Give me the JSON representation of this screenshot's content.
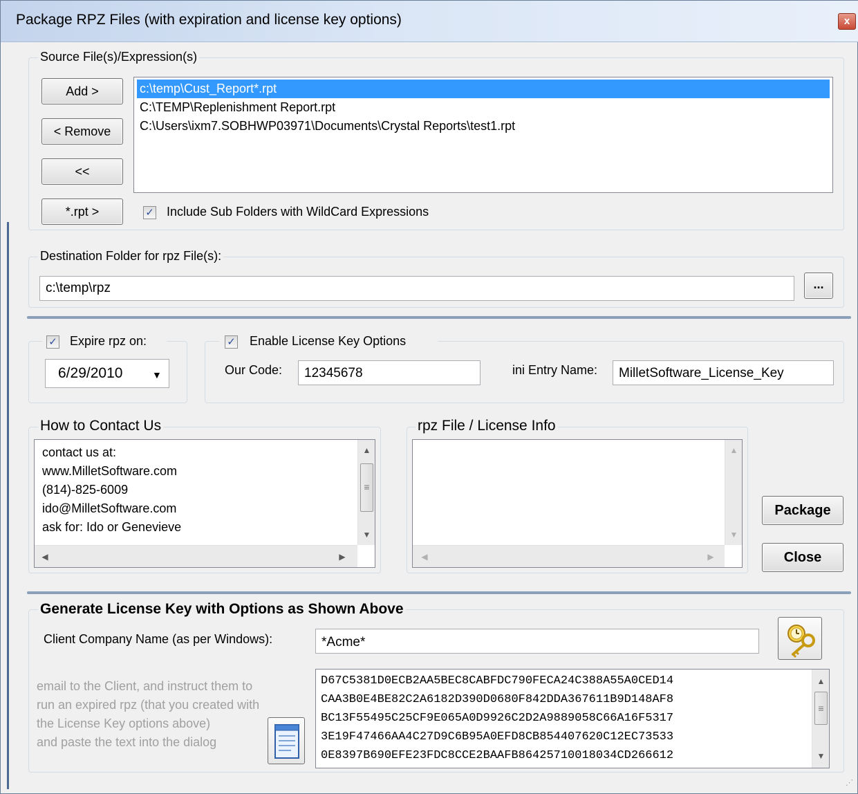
{
  "window": {
    "title": "Package RPZ Files (with expiration and license key options)",
    "close_glyph": "x"
  },
  "source": {
    "group_label": "Source File(s)/Expression(s)",
    "add_label": "Add >",
    "remove_label": "< Remove",
    "clear_label": "<<",
    "rpt_label": "*.rpt >",
    "files": [
      "c:\\temp\\Cust_Report*.rpt",
      "C:\\TEMP\\Replenishment Report.rpt",
      "C:\\Users\\ixm7.SOBHWP03971\\Documents\\Crystal Reports\\test1.rpt"
    ],
    "include_sub_label": "Include Sub Folders with WildCard Expressions",
    "include_sub_checked": true
  },
  "destination": {
    "group_label": "Destination Folder for rpz File(s):",
    "value": "c:\\temp\\rpz",
    "browse_label": "..."
  },
  "expire": {
    "label": "Expire rpz on:",
    "checked": true,
    "date": "6/29/2010"
  },
  "license": {
    "label": "Enable License Key Options",
    "checked": true,
    "our_code_label": "Our Code:",
    "our_code_value": "12345678",
    "ini_label": "ini Entry Name:",
    "ini_value": "MilletSoftware_License_Key"
  },
  "contact": {
    "group_label": "How to Contact Us",
    "lines": [
      "contact us at:",
      "www.MilletSoftware.com",
      "(814)-825-6009",
      "ido@MilletSoftware.com",
      "ask for: Ido or Genevieve"
    ]
  },
  "rpz_info": {
    "group_label": "rpz File / License Info"
  },
  "actions": {
    "package_label": "Package",
    "close_label": "Close"
  },
  "generate": {
    "group_label": "Generate License Key with Options as Shown Above",
    "client_label": "Client Company Name (as per Windows):",
    "client_value": "*Acme*",
    "hint_lines": [
      "email to the Client, and instruct them to",
      "run an expired rpz (that you created with",
      "the License Key options above)",
      "and paste the text into the dialog"
    ],
    "key_lines": [
      "D67C5381D0ECB2AA5BEC8CABFDC790FECA24C388A55A0CED14",
      "CAA3B0E4BE82C2A6182D390D0680F842DDA367611B9D148AF8",
      "BC13F55495C25CF9E065A0D9926C2D2A9889058C66A16F5317",
      "3E19F47466AA4C27D9C6B95A0EFD8CB854407620C12EC73533",
      "0E8397B690EFE23FDC8CCE2BAAFB86425710018034CD266612"
    ]
  },
  "icons": {
    "check": "✓",
    "dropdown": "▼",
    "up": "▲",
    "down": "▼",
    "left": "◀",
    "right": "▶",
    "grip": "≡",
    "check_color": "#2d4e9c",
    "selection_color": "#3399ff"
  }
}
